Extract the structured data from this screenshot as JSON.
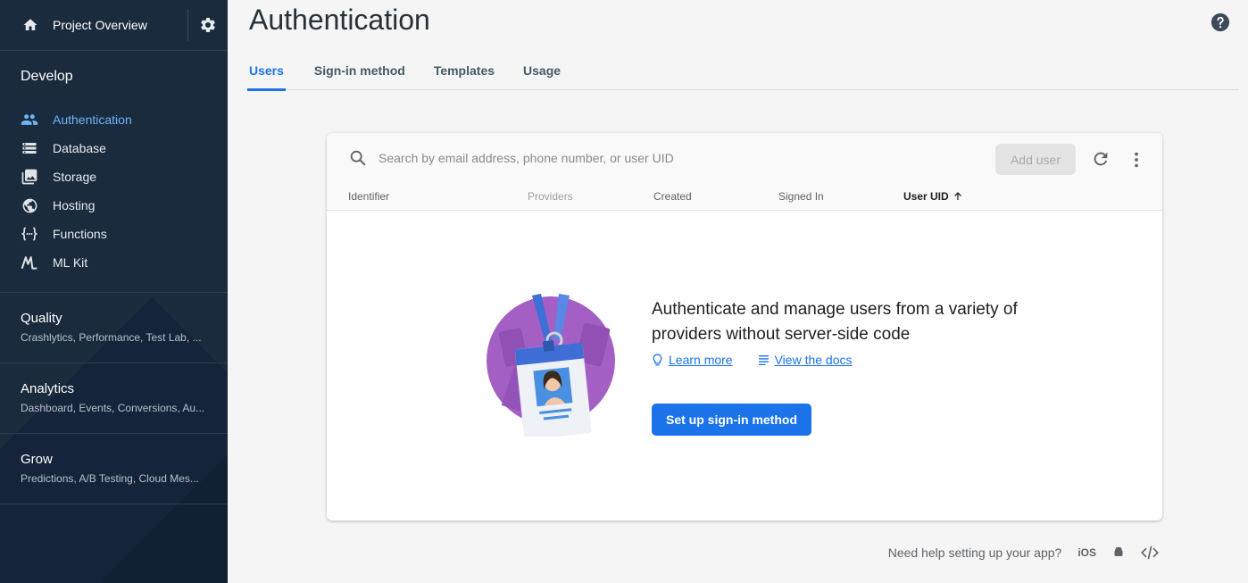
{
  "sidebar": {
    "project_overview": "Project Overview",
    "develop_heading": "Develop",
    "items": [
      {
        "label": "Authentication",
        "icon": "people-icon",
        "active": true
      },
      {
        "label": "Database",
        "icon": "database-icon"
      },
      {
        "label": "Storage",
        "icon": "image-icon"
      },
      {
        "label": "Hosting",
        "icon": "globe-icon"
      },
      {
        "label": "Functions",
        "icon": "functions-icon"
      },
      {
        "label": "ML Kit",
        "icon": "mlkit-icon"
      }
    ],
    "groups": [
      {
        "title": "Quality",
        "subtitle": "Crashlytics, Performance, Test Lab, ..."
      },
      {
        "title": "Analytics",
        "subtitle": "Dashboard, Events, Conversions, Au..."
      },
      {
        "title": "Grow",
        "subtitle": "Predictions, A/B Testing, Cloud Mes..."
      }
    ]
  },
  "header": {
    "title": "Authentication",
    "tabs": [
      {
        "label": "Users",
        "active": true
      },
      {
        "label": "Sign-in method"
      },
      {
        "label": "Templates"
      },
      {
        "label": "Usage"
      }
    ]
  },
  "table": {
    "search_placeholder": "Search by email address, phone number, or user UID",
    "add_user_label": "Add user",
    "columns": [
      "Identifier",
      "Providers",
      "Created",
      "Signed In",
      "User UID"
    ]
  },
  "empty_state": {
    "title": "Authenticate and manage users from a variety of providers without server-side code",
    "learn_more": "Learn more",
    "view_docs": "View the docs",
    "cta": "Set up sign-in method"
  },
  "footer": {
    "help_text": "Need help setting up your app?",
    "ios_label": "iOS"
  },
  "colors": {
    "sidebar_bg": "#1a2b3e",
    "accent": "#1a73e8",
    "active_nav": "#6fb3f5",
    "illustration": "#a45fc4"
  }
}
